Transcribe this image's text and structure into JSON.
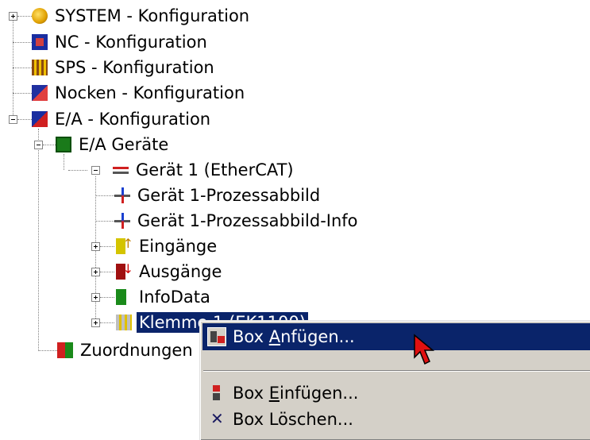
{
  "tree": {
    "system": "SYSTEM - Konfiguration",
    "nc": "NC - Konfiguration",
    "sps": "SPS - Konfiguration",
    "nocken": "Nocken - Konfiguration",
    "ea": "E/A - Konfiguration",
    "ea_geraete": "E/A Geräte",
    "geraet1": "Gerät 1 (EtherCAT)",
    "prozessabbild": "Gerät 1-Prozessabbild",
    "prozessabbild_info": "Gerät 1-Prozessabbild-Info",
    "eingaenge": "Eingänge",
    "ausgaenge": "Ausgänge",
    "infodata": "InfoData",
    "klemme1": "Klemme 1 (EK1100)",
    "zuordnungen": "Zuordnungen"
  },
  "context_menu": {
    "anfuegen": {
      "label": "Box ",
      "accel": "A",
      "rest": "nfügen..."
    },
    "einfuegen": {
      "label": "Box ",
      "accel": "E",
      "rest": "infügen..."
    },
    "loeschen": {
      "label": "Box Löschen..."
    }
  },
  "colors": {
    "selection": "#0a246a",
    "menu_bg": "#d4d0c8"
  }
}
